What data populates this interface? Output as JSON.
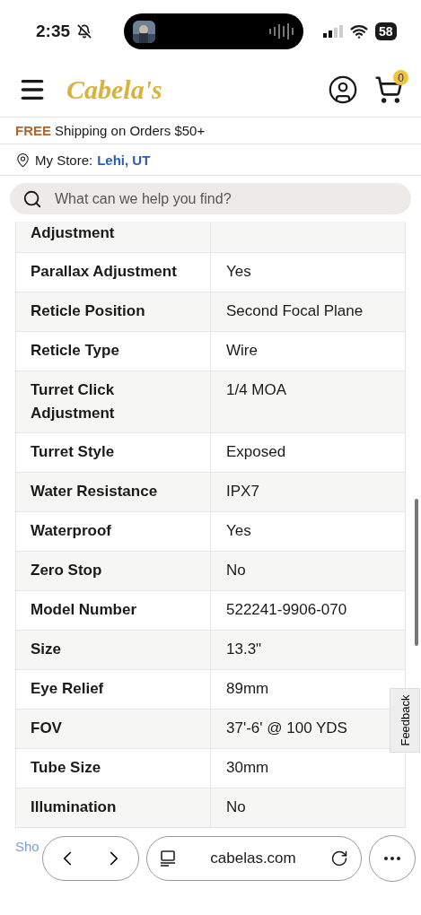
{
  "status_bar": {
    "time": "2:35",
    "battery": "58"
  },
  "header": {
    "logo": "Cabela's",
    "cart_count": "0"
  },
  "promo": {
    "highlight": "FREE",
    "text": "Shipping on Orders $50+"
  },
  "store": {
    "label": "My Store:",
    "value": "Lehi, UT"
  },
  "search": {
    "placeholder": "What can we help you find?"
  },
  "specs": [
    {
      "label": "Adjustment"
    },
    {
      "label": "Parallax Adjustment",
      "value": "Yes"
    },
    {
      "label": "Reticle Position",
      "value": "Second Focal Plane"
    },
    {
      "label": "Reticle Type",
      "value": "Wire"
    },
    {
      "label": "Turret Click Adjustment",
      "value": "1/4 MOA"
    },
    {
      "label": "Turret Style",
      "value": "Exposed"
    },
    {
      "label": "Water Resistance",
      "value": "IPX7"
    },
    {
      "label": "Waterproof",
      "value": "Yes"
    },
    {
      "label": "Zero Stop",
      "value": "No"
    },
    {
      "label": "Model Number",
      "value": "522241-9906-070"
    },
    {
      "label": "Size",
      "value": "13.3\""
    },
    {
      "label": "Eye Relief",
      "value": "89mm"
    },
    {
      "label": "FOV",
      "value": "37'-6' @ 100 YDS"
    },
    {
      "label": "Tube Size",
      "value": "30mm"
    },
    {
      "label": "Illumination",
      "value": "No"
    }
  ],
  "more_link": "Sho",
  "feedback": "Feedback",
  "browser": {
    "url": "cabelas.com"
  }
}
